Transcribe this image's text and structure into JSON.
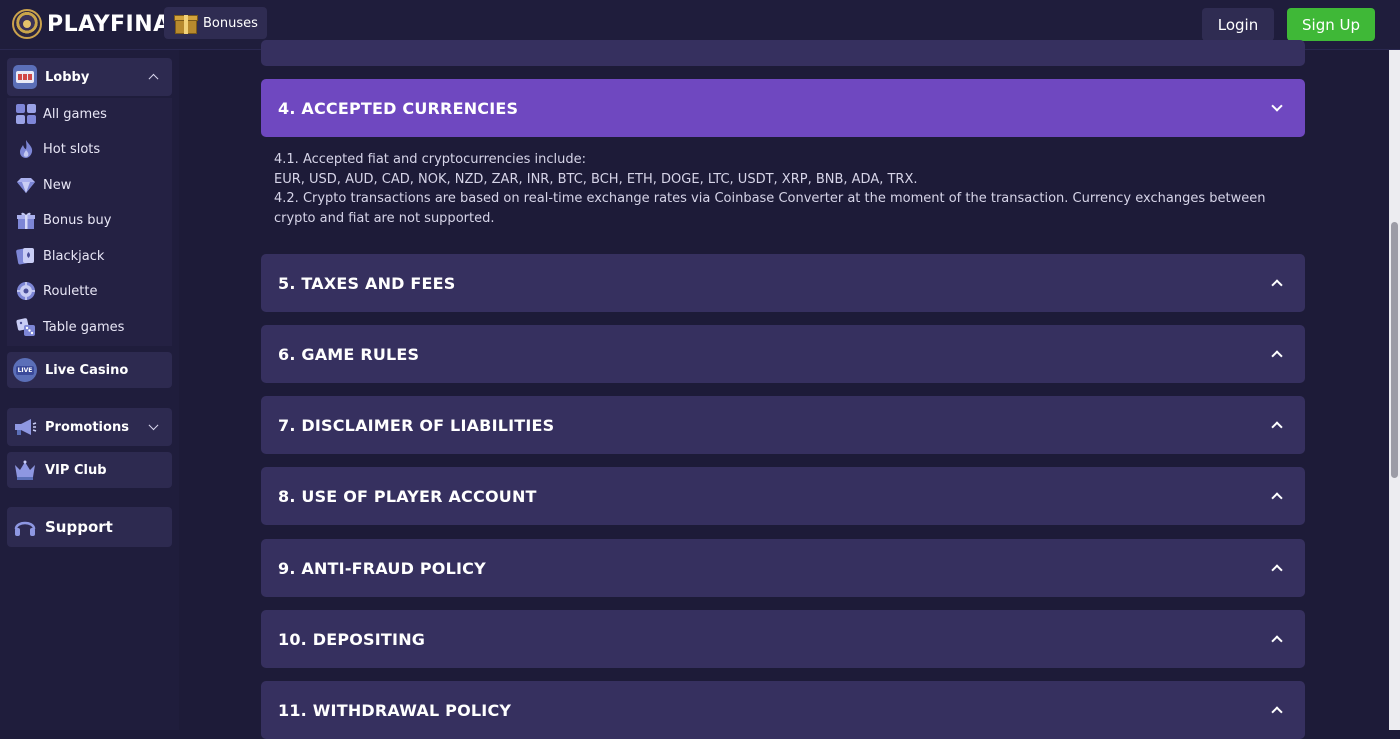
{
  "header": {
    "brand": "PLAYFINA",
    "bonuses_label": "Bonuses",
    "login_label": "Login",
    "signup_label": "Sign Up"
  },
  "sidebar": {
    "lobby_label": "Lobby",
    "lobby_items": [
      {
        "label": "All games",
        "icon": "grid-icon"
      },
      {
        "label": "Hot slots",
        "icon": "flame-icon"
      },
      {
        "label": "New",
        "icon": "diamond-icon"
      },
      {
        "label": "Bonus buy",
        "icon": "gift-icon"
      },
      {
        "label": "Blackjack",
        "icon": "cards-icon"
      },
      {
        "label": "Roulette",
        "icon": "roulette-icon"
      },
      {
        "label": "Table games",
        "icon": "dice-icon"
      }
    ],
    "live_casino_label": "Live Casino",
    "live_badge": "LIVE",
    "promotions_label": "Promotions",
    "vip_label": "VIP Club",
    "support_label": "Support"
  },
  "content": {
    "sections": [
      {
        "title": "4. ACCEPTED CURRENCIES",
        "expanded": true
      },
      {
        "title": "5. TAXES AND FEES",
        "expanded": false
      },
      {
        "title": "6. GAME RULES",
        "expanded": false
      },
      {
        "title": "7. DISCLAIMER OF LIABILITIES",
        "expanded": false
      },
      {
        "title": "8. USE OF PLAYER ACCOUNT",
        "expanded": false
      },
      {
        "title": "9. ANTI-FRAUD POLICY",
        "expanded": false
      },
      {
        "title": "10. DEPOSITING",
        "expanded": false
      },
      {
        "title": "11. WITHDRAWAL POLICY",
        "expanded": false
      }
    ],
    "currencies_body": {
      "line1": "4.1. Accepted fiat and cryptocurrencies include:",
      "line2": "EUR, USD, AUD, CAD, NOK, NZD, ZAR, INR, BTC, BCH, ETH, DOGE, LTC, USDT, XRP, BNB, ADA, TRX.",
      "line3": "4.2. Crypto transactions are based on real-time exchange rates via Coinbase Converter at the moment of the transaction. Currency exchanges between crypto and fiat are not supported."
    }
  },
  "colors": {
    "background": "#1d1b38",
    "panel": "#36305f",
    "accent_open": "#6f48c0",
    "signup_green": "#3fb837"
  }
}
